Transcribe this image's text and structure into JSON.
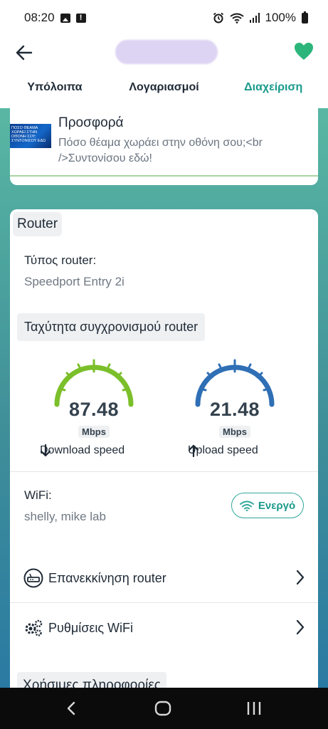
{
  "status_bar": {
    "time": "08:20",
    "battery": "100%"
  },
  "tabs": [
    {
      "label": "Υπόλοιπα",
      "active": false
    },
    {
      "label": "Λογαριασμοί",
      "active": false
    },
    {
      "label": "Διαχείριση",
      "active": true
    }
  ],
  "promo": {
    "title": "Προσφορά",
    "text": "Πόσο θέαμα χωράει στην οθόνη σου;<br />Συντονίσου εδώ!",
    "image_text": "ΠΟΣΟ ΘΕΑΜΑ ΧΩΡΑΕΙ ΣΤΗΝ ΟΘΟΝΗ ΣΟΥ; ΣΥΝΤΟΝΙΣΟΥ ΕΔΩ"
  },
  "router": {
    "heading": "Router",
    "type_label": "Τύπος router:",
    "type_value": "Speedport Entry 2i",
    "sync_heading": "Ταχύτητα συγχρονισμού router",
    "download": {
      "value": "87.48",
      "unit": "Mbps",
      "caption": "Download speed",
      "color": "#7bbf2a"
    },
    "upload": {
      "value": "21.48",
      "unit": "Mbps",
      "caption": "Upload speed",
      "color": "#2f6fb5"
    },
    "wifi_label": "WiFi:",
    "wifi_value": "shelly, mike lab",
    "wifi_status": "Ενεργό",
    "restart_label": "Επανεκκίνηση router",
    "wifi_settings_label": "Ρυθμίσεις WiFi"
  },
  "useful_info": {
    "heading": "Χρήσιμες πληροφορίες"
  },
  "colors": {
    "accent": "#1a9a8c",
    "heart": "#2bb57a"
  },
  "icons": [
    "back-arrow-icon",
    "heart-icon",
    "wifi-icon",
    "router-icon",
    "gears-icon",
    "chevron-right-icon",
    "arrow-down-icon",
    "arrow-up-icon"
  ]
}
